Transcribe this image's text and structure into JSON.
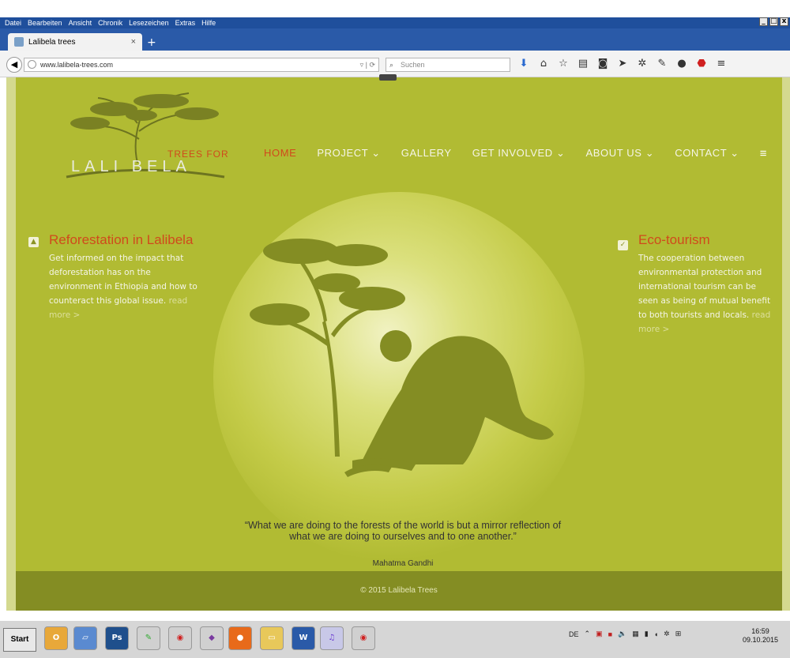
{
  "browser": {
    "menu": [
      "Datei",
      "Bearbeiten",
      "Ansicht",
      "Chronik",
      "Lesezeichen",
      "Extras",
      "Hilfe"
    ],
    "tab_title": "Lalibela trees",
    "tab_close": "×",
    "new_tab": "+",
    "url": "www.lalibela-trees.com",
    "search_placeholder": "Suchen",
    "window_controls": [
      "_",
      "□",
      "x"
    ],
    "toolbar_icons": [
      "download-icon",
      "home-icon",
      "bookmark-star-icon",
      "reading-list-icon",
      "pocket-icon",
      "send-icon",
      "extension-icon",
      "extension-icon-2",
      "chat-icon",
      "adblock-icon",
      "menu-icon"
    ]
  },
  "site": {
    "logo_trees_for": "TREES FOR",
    "logo_lali": "LALI",
    "logo_bela": "BELA",
    "nav": [
      "HOME",
      "PROJECT ⌄",
      "GALLERY",
      "GET INVOLVED ⌄",
      "ABOUT US ⌄",
      "CONTACT ⌄"
    ],
    "nav_menu_glyph": "≡",
    "left": {
      "title": "Reforestation in Lalibela",
      "text": "Get informed on the impact that deforestation has on the environment in Ethiopia and how to counteract this global issue.",
      "more": "read more >"
    },
    "right": {
      "title": "Eco-tourism",
      "text": "The cooperation between environmental protection and international tourism can be seen as being of mutual benefit to both tourists and locals.",
      "more": "read more >"
    },
    "quote_line1": "“What we are doing to the forests of the world is but a mirror reflection of",
    "quote_line2": "what we are doing to ourselves and to one another.”",
    "author": "Mahatma Gandhi",
    "footer": "© 2015 Lalibela Trees",
    "colors": {
      "accent": "#d04a1c",
      "background": "#b1bb33",
      "footer": "#848d23"
    }
  },
  "taskbar": {
    "start": "Start",
    "lang": "DE",
    "time": "16:59",
    "date": "09.10.2015",
    "apps": [
      "outlook-icon",
      "virtualbox-icon",
      "photoshop-icon",
      "inkscape-icon",
      "screenshot-icon",
      "inkscape-2-icon",
      "firefox-icon",
      "explorer-icon",
      "word-icon",
      "itunes-icon",
      "screenshot-2-icon"
    ]
  }
}
